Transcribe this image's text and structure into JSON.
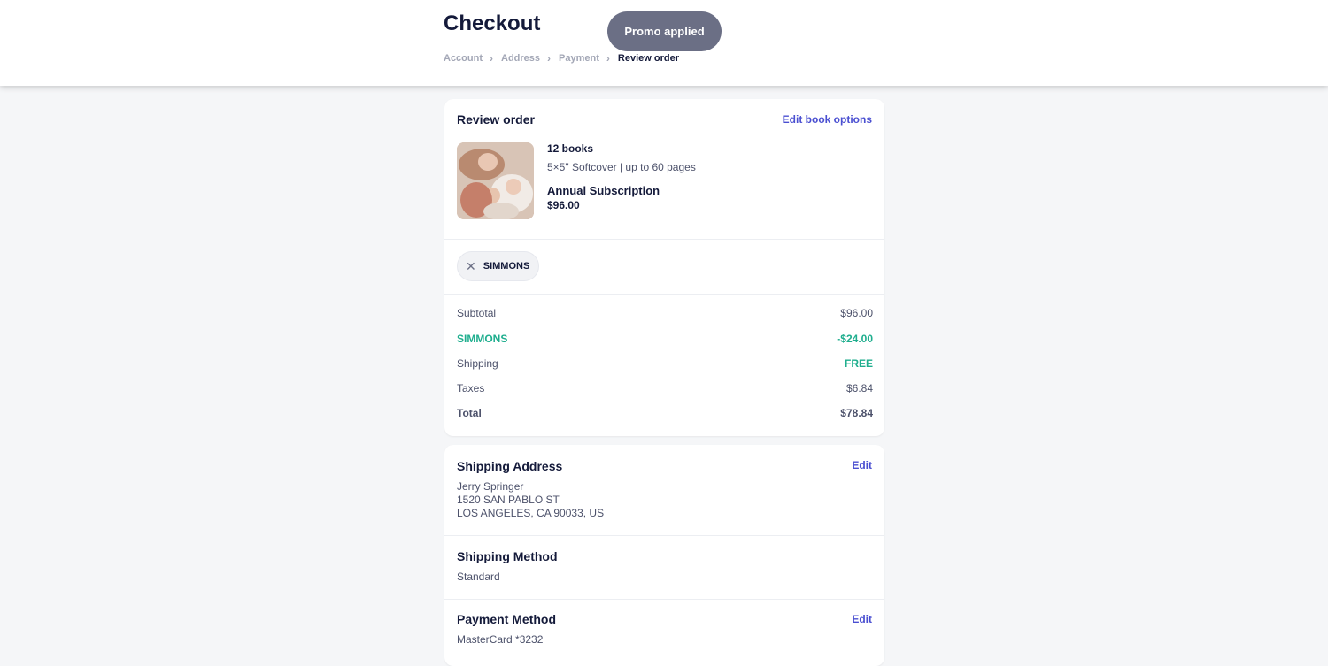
{
  "header": {
    "title": "Checkout",
    "toast": "Promo applied",
    "breadcrumb": [
      "Account",
      "Address",
      "Payment",
      "Review order"
    ]
  },
  "order": {
    "title": "Review order",
    "edit_link": "Edit book options",
    "product": {
      "quantity": "12 books",
      "description": "5×5\" Softcover | up to 60 pages",
      "plan": "Annual Subscription",
      "price": "$96.00"
    },
    "promo_code": "SIMMONS",
    "summary": {
      "subtotal_label": "Subtotal",
      "subtotal_value": "$96.00",
      "discount_label": "SIMMONS",
      "discount_value": "-$24.00",
      "shipping_label": "Shipping",
      "shipping_value": "FREE",
      "taxes_label": "Taxes",
      "taxes_value": "$6.84",
      "total_label": "Total",
      "total_value": "$78.84"
    }
  },
  "shipping_address": {
    "title": "Shipping Address",
    "edit_link": "Edit",
    "name": "Jerry Springer",
    "street": "1520 SAN PABLO ST",
    "city": "LOS ANGELES, CA 90033, US"
  },
  "shipping_method": {
    "title": "Shipping Method",
    "value": "Standard"
  },
  "payment_method": {
    "title": "Payment Method",
    "edit_link": "Edit",
    "value": "MasterCard *3232"
  },
  "colors": {
    "accent": "#4a4fd1",
    "discount": "#1fae8e",
    "toast_bg": "#6b6f85"
  }
}
